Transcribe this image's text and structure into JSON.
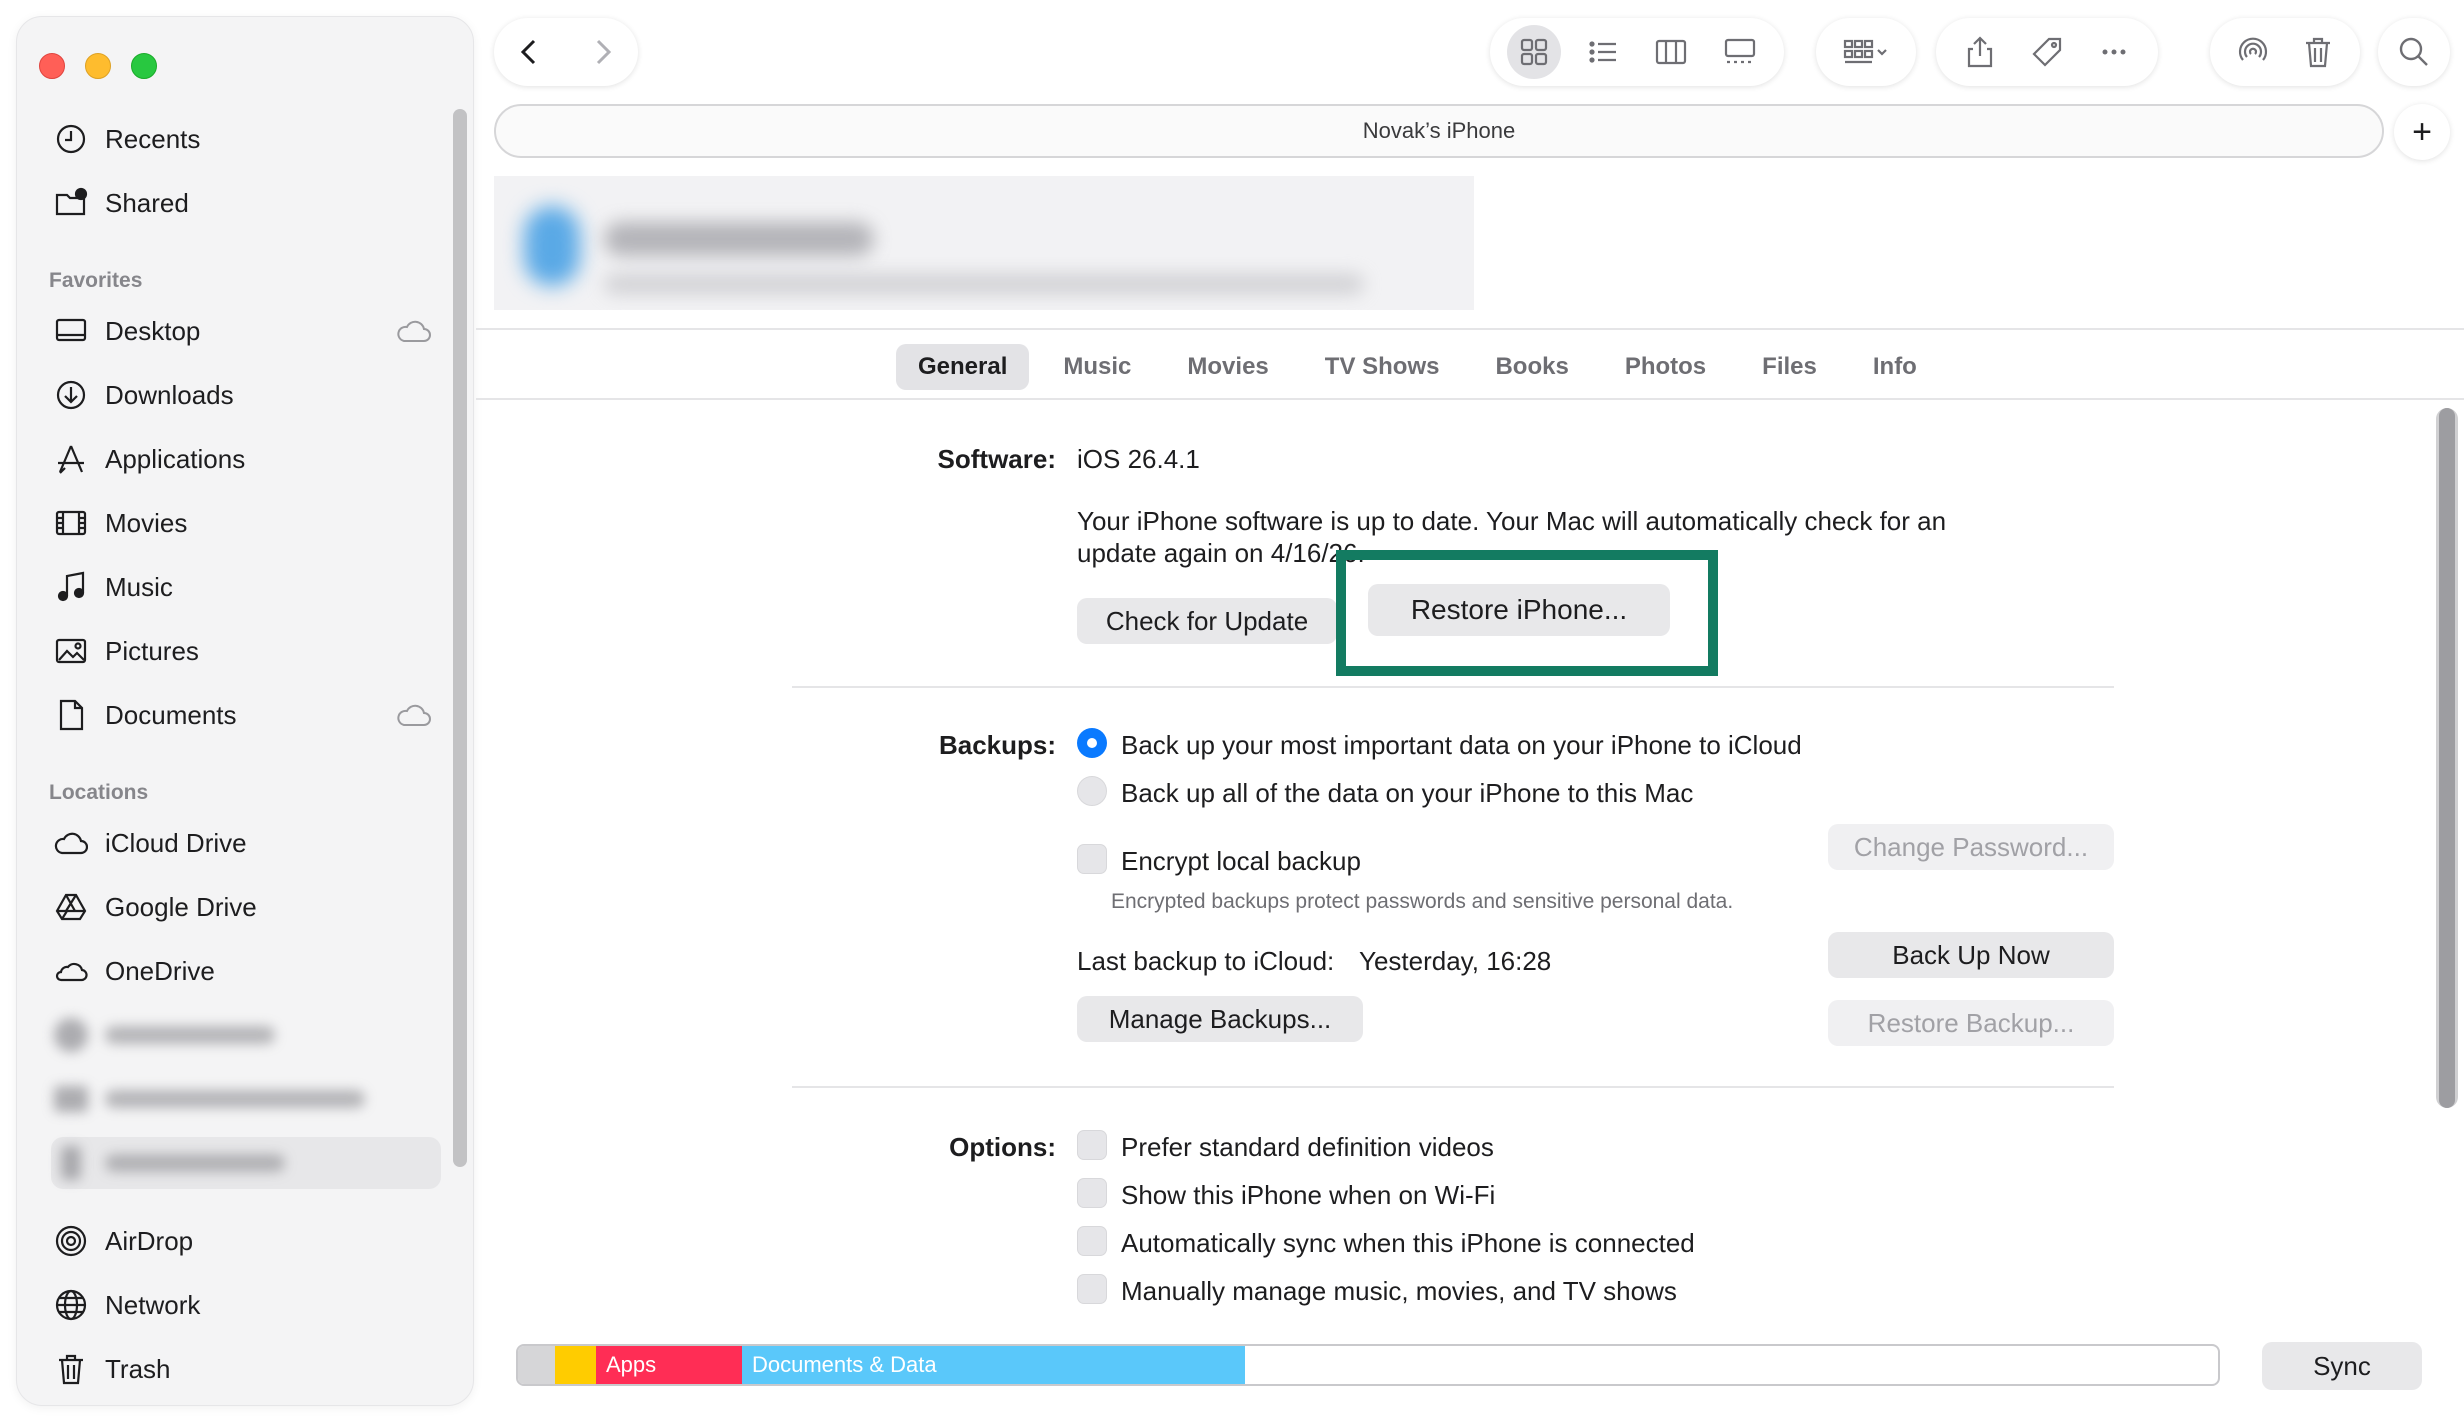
{
  "sidebar": {
    "top_items": [
      {
        "label": "Recents",
        "icon": "clock-icon"
      },
      {
        "label": "Shared",
        "icon": "shared-folder-icon"
      }
    ],
    "favorites_header": "Favorites",
    "favorites": [
      {
        "label": "Desktop",
        "icon": "desktop-icon",
        "cloud": true
      },
      {
        "label": "Downloads",
        "icon": "download-icon",
        "cloud": false
      },
      {
        "label": "Applications",
        "icon": "applications-icon",
        "cloud": false
      },
      {
        "label": "Movies",
        "icon": "film-icon",
        "cloud": false
      },
      {
        "label": "Music",
        "icon": "music-note-icon",
        "cloud": false
      },
      {
        "label": "Pictures",
        "icon": "photo-icon",
        "cloud": false
      },
      {
        "label": "Documents",
        "icon": "document-icon",
        "cloud": true
      }
    ],
    "locations_header": "Locations",
    "locations": [
      {
        "label": "iCloud Drive",
        "icon": "cloud-icon"
      },
      {
        "label": "Google Drive",
        "icon": "google-drive-icon"
      },
      {
        "label": "OneDrive",
        "icon": "onedrive-icon"
      }
    ],
    "bottom_items": [
      {
        "label": "AirDrop",
        "icon": "airdrop-icon"
      },
      {
        "label": "Network",
        "icon": "globe-icon"
      },
      {
        "label": "Trash",
        "icon": "trash-icon"
      }
    ]
  },
  "toolbar": {
    "path_title": "Novak’s iPhone",
    "plus": "+"
  },
  "tabs": [
    "General",
    "Music",
    "Movies",
    "TV Shows",
    "Books",
    "Photos",
    "Files",
    "Info"
  ],
  "active_tab": "General",
  "software": {
    "label": "Software:",
    "version": "iOS 26.4.1",
    "status_line1": "Your iPhone software is up to date. Your Mac will automatically check for an",
    "status_line2": "update again on 4/16/26.",
    "check_button": "Check for Update",
    "restore_button": "Restore iPhone..."
  },
  "backups": {
    "label": "Backups:",
    "option_icloud": "Back up your most important data on your iPhone to iCloud",
    "option_mac": "Back up all of the data on your iPhone to this Mac",
    "encrypt": "Encrypt local backup",
    "encrypt_note": "Encrypted backups protect passwords and sensitive personal data.",
    "change_password": "Change Password...",
    "last_backup_label": "Last backup to iCloud:",
    "last_backup_value": "Yesterday, 16:28",
    "back_up_now": "Back Up Now",
    "manage_backups": "Manage Backups...",
    "restore_backup": "Restore Backup..."
  },
  "options": {
    "label": "Options:",
    "items": [
      "Prefer standard definition videos",
      "Show this iPhone when on Wi-Fi",
      "Automatically sync when this iPhone is connected",
      "Manually manage music, movies, and TV shows"
    ]
  },
  "storage": {
    "segments": [
      {
        "label": "",
        "fraction": 0.022,
        "color": "#d6d6d8"
      },
      {
        "label": "",
        "fraction": 0.024,
        "color": "#ffcc00"
      },
      {
        "label": "Apps",
        "fraction": 0.086,
        "color": "#ff2d55"
      },
      {
        "label": "Documents & Data",
        "fraction": 0.296,
        "color": "#5ac8fa"
      }
    ],
    "sync_button": "Sync"
  },
  "colors": {
    "accent": "#0a7aff",
    "highlight_box": "#137b61"
  }
}
